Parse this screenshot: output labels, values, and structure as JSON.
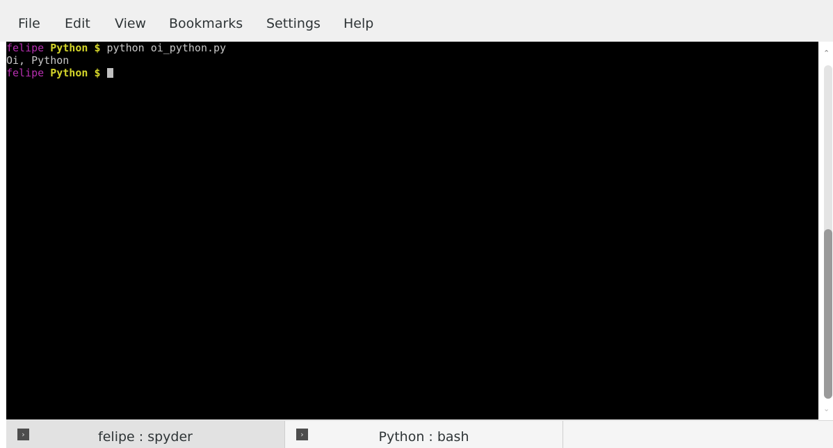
{
  "menubar": {
    "items": [
      "File",
      "Edit",
      "View",
      "Bookmarks",
      "Settings",
      "Help"
    ]
  },
  "terminal": {
    "line1": {
      "user": "felipe",
      "dir": "Python",
      "prompt": "$",
      "command": "python oi_python.py"
    },
    "line2": {
      "output": "Oi, Python"
    },
    "line3": {
      "user": "felipe",
      "dir": "Python",
      "prompt": "$"
    }
  },
  "scrollbar": {
    "up_icon": "chevron-up-icon",
    "down_icon": "chevron-down-icon"
  },
  "tabs": [
    {
      "label": "felipe : spyder",
      "icon": "terminal-icon",
      "active": true
    },
    {
      "label": "Python : bash",
      "icon": "terminal-icon",
      "active": false
    }
  ],
  "colors": {
    "terminal_bg": "#000000",
    "prompt_user": "#b62fb0",
    "prompt_dir": "#d4d52a",
    "text": "#c9c9c9"
  }
}
